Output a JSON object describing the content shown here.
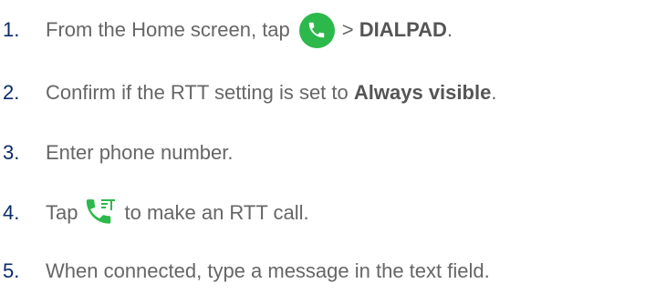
{
  "colors": {
    "number": "#0a2a6a",
    "text": "#666666",
    "phone_green": "#2db84b"
  },
  "icons": {
    "phone": "phone-icon",
    "rtt_call": "rtt-call-icon"
  },
  "steps": [
    {
      "number": "1.",
      "text_before": "From the Home screen, tap",
      "text_middle": ">",
      "bold": "DIALPAD",
      "text_after": "."
    },
    {
      "number": "2.",
      "text_before": "Confirm if the RTT setting is set to",
      "bold": "Always visible",
      "text_after": "."
    },
    {
      "number": "3.",
      "text": "Enter phone number."
    },
    {
      "number": "4.",
      "text_before": "Tap",
      "text_after": "to make an RTT call."
    },
    {
      "number": "5.",
      "text": "When connected, type a message in the text field."
    }
  ]
}
